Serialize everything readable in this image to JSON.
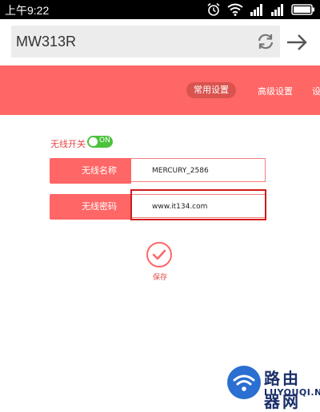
{
  "status_bar": {
    "time": "上午9:22"
  },
  "address_bar": {
    "url": "MW313R"
  },
  "nav": {
    "active_tab": "常用设置",
    "advanced_tab": "高级设置",
    "partial_tab": "设"
  },
  "wireless": {
    "switch_label": "无线开关",
    "switch_state": "ON",
    "ssid_label": "无线名称",
    "ssid_value": "MERCURY_2586",
    "password_label": "无线密码",
    "password_value": "www.it134.com"
  },
  "actions": {
    "save_label": "保存"
  },
  "watermark": {
    "cn_text": "路由器网",
    "en_text": "LUYOUQI.NET"
  },
  "colors": {
    "brand_red": "#ff6666",
    "active_tab_bg": "#d9534f",
    "toggle_on": "#4cc23b",
    "highlight_border": "#d11a1a"
  }
}
